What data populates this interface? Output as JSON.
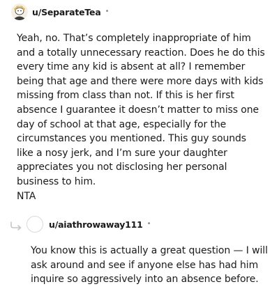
{
  "comment": {
    "username": "u/SeparateTea",
    "dot": "•",
    "body": "Yeah, no. That’s completely inappropriate of him and a totally unnecessary reaction. Does he do this every time any kid is absent at all? I remember being that age and there were more days with kids missing from class than not. If this is her first absence I guarantee it doesn’t matter to miss one day of school at that age, especially for the circumstances you mentioned. This guy sounds like a nosy jerk, and I’m sure your daughter appreciates you not disclosing her personal business to him.",
    "verdict": "NTA",
    "avatar_icon": "snoo-avatar-icon"
  },
  "reply": {
    "username": "u/aiathrowaway111",
    "dot": "•",
    "body": "You know this is actually a great question — I will ask around and see if anyone else has had him inquire so aggressively into an absence before.",
    "avatar_icon": "blank-avatar-icon",
    "reply_icon": "reply-arrow-icon"
  }
}
